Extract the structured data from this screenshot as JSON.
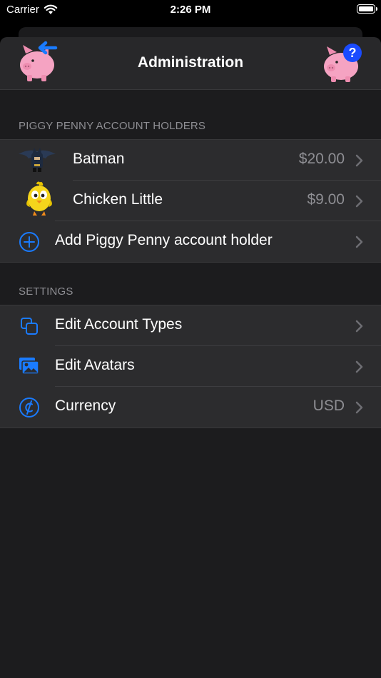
{
  "status_bar": {
    "carrier": "Carrier",
    "time": "2:26 PM"
  },
  "nav": {
    "title": "Administration"
  },
  "account_holders": {
    "header": "PIGGY PENNY ACCOUNT HOLDERS",
    "items": [
      {
        "name": "Batman",
        "balance": "$20.00"
      },
      {
        "name": "Chicken Little",
        "balance": "$9.00"
      }
    ],
    "add_label": "Add Piggy Penny account holder"
  },
  "settings": {
    "header": "SETTINGS",
    "items": [
      {
        "label": "Edit Account Types",
        "icon": "squares-icon"
      },
      {
        "label": "Edit Avatars",
        "icon": "photos-icon"
      },
      {
        "label": "Currency",
        "value": "USD",
        "icon": "cent-sign-icon"
      }
    ]
  },
  "colors": {
    "accent": "#1a7bff",
    "pig": "#f5a3c2",
    "background": "#1c1c1e",
    "cell": "#2c2c2e"
  }
}
